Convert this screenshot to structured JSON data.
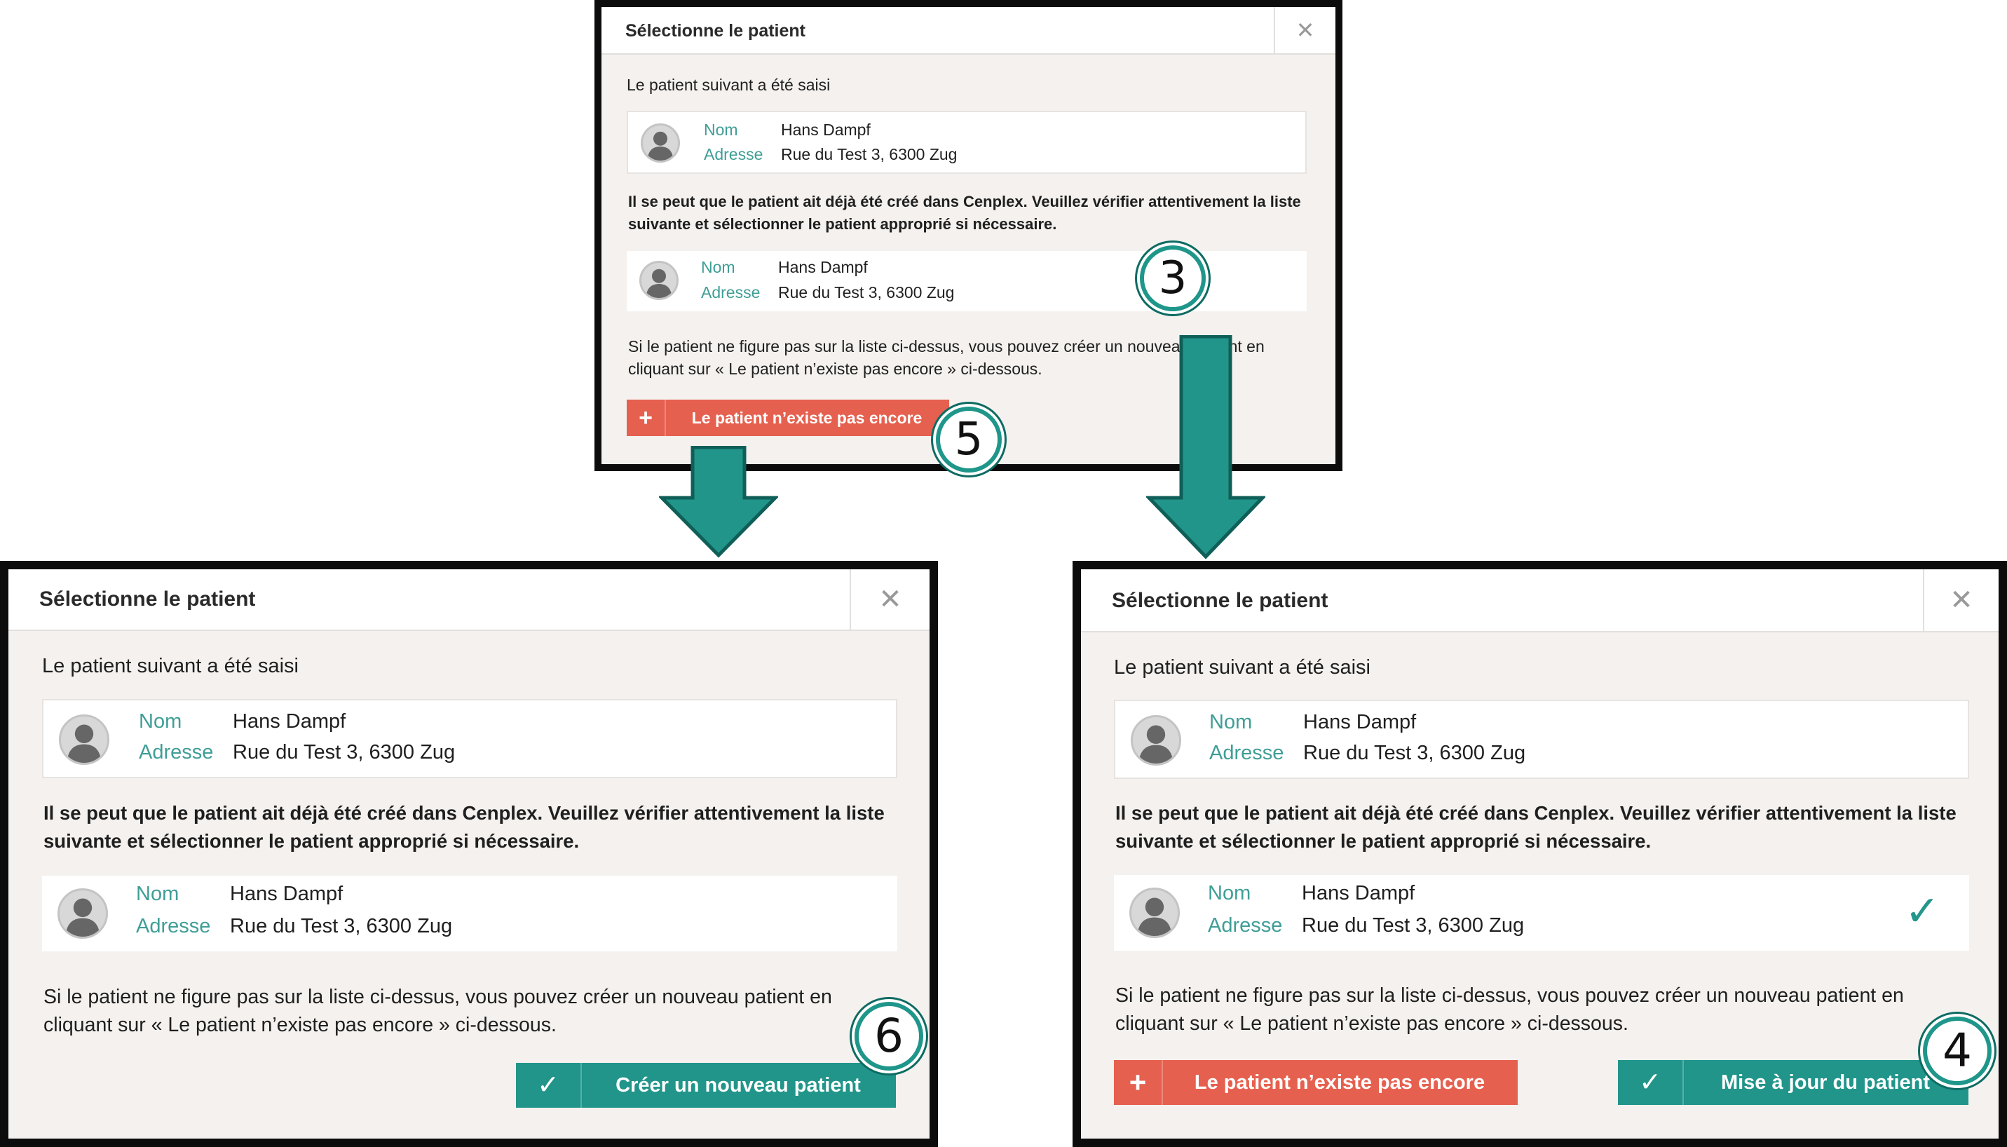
{
  "dialog": {
    "title": "Sélectionne le patient",
    "close_glyph": "✕",
    "intro": "Le patient suivant a été saisi",
    "patient": {
      "name_label": "Nom",
      "name": "Hans Dampf",
      "address_label": "Adresse",
      "address": "Rue du Test 3, 6300 Zug"
    },
    "warning": "Il se peut que le patient ait déjà été créé dans Cenplex. Veuillez vérifier attentivement la liste suivante et sélectionner le patient approprié si nécessaire.",
    "match": {
      "name_label": "Nom",
      "name": "Hans Dampf",
      "address_label": "Adresse",
      "address": "Rue du Test 3, 6300 Zug"
    },
    "hint": "Si le patient ne figure pas sur la liste ci-dessus, vous pouvez créer un nouveau patient en cliquant sur « Le patient n’existe pas encore » ci-dessous.",
    "btn_not_exist": "Le patient n’existe pas encore",
    "btn_create": "Créer un nouveau patient",
    "btn_update": "Mise à jour du patient",
    "plus_glyph": "+",
    "check_glyph": "✓"
  },
  "steps": {
    "step3": "3",
    "step4": "4",
    "step5": "5",
    "step6": "6"
  },
  "colors": {
    "accent_teal": "#21958a",
    "danger_red": "#e6604f",
    "label_teal": "#3f9e96",
    "dialog_bg": "#f4f1ee"
  }
}
